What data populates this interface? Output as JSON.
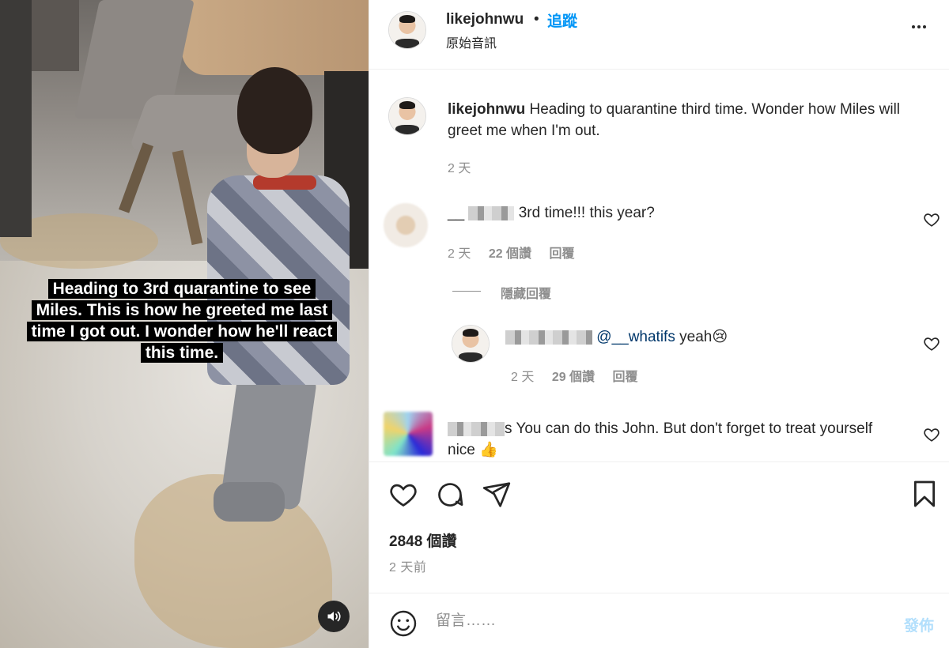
{
  "media": {
    "caption_lines": [
      "Heading to 3rd quarantine to see",
      "Miles. This is how he greeted me last",
      "time I got out. I wonder how he'll react",
      "this time."
    ],
    "sound_icon": "speaker-icon"
  },
  "header": {
    "username": "likejohnwu",
    "dot": "•",
    "follow_label": "追蹤",
    "audio_label": "原始音訊",
    "more_icon": "more-options-icon"
  },
  "caption": {
    "username": "likejohnwu",
    "text": "Heading to quarantine third time. Wonder how Miles will greet me when I'm out.",
    "time": "2 天"
  },
  "comments": [
    {
      "prefix": "__",
      "text": "3rd time!!! this year?",
      "time": "2 天",
      "likes": "22 個讚",
      "reply_label": "回覆"
    },
    {
      "prefix": "",
      "text": "You can do this John. But don't forget to treat yourself nice 👍",
      "partial": "s"
    }
  ],
  "hidden_replies_label": "隱藏回覆",
  "reply": {
    "mention": "@__whatifs",
    "text": " yeah😢",
    "time": "2 天",
    "likes": "29 個讚",
    "reply_label": "回覆"
  },
  "actions": {
    "likes": "2848 個讚",
    "posted": "2 天前"
  },
  "composer": {
    "placeholder": "留言……",
    "post_label": "發佈"
  },
  "colors": {
    "accent": "#0095f6",
    "muted": "#8e8e8e",
    "text": "#262626",
    "post_disabled": "#b2dffc"
  }
}
